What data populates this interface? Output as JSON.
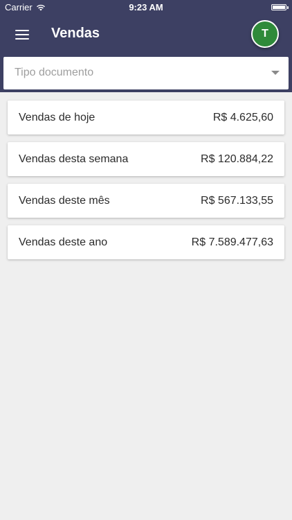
{
  "status_bar": {
    "carrier": "Carrier",
    "time": "9:23 AM"
  },
  "app_bar": {
    "title": "Vendas",
    "avatar_initial": "T"
  },
  "filter": {
    "placeholder": "Tipo documento"
  },
  "sales": [
    {
      "label": "Vendas de hoje",
      "value": "R$ 4.625,60"
    },
    {
      "label": "Vendas desta semana",
      "value": "R$ 120.884,22"
    },
    {
      "label": "Vendas deste mês",
      "value": "R$ 567.133,55"
    },
    {
      "label": "Vendas deste ano",
      "value": "R$ 7.589.477,63"
    }
  ],
  "colors": {
    "header": "#3d4063",
    "avatar": "#2f8a3a",
    "background": "#efefef"
  }
}
